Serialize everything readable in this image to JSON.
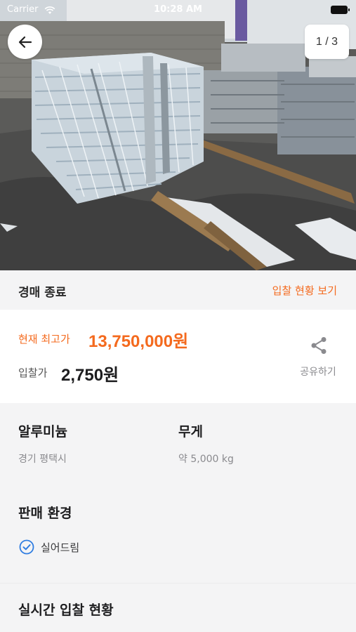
{
  "status_bar": {
    "carrier": "Carrier",
    "time": "10:28 AM"
  },
  "gallery": {
    "indicator": "1 / 3"
  },
  "auction": {
    "status": "경매 종료",
    "bid_status_link": "입찰 현황 보기"
  },
  "price": {
    "current_label": "현재 최고가",
    "current_value": "13,750,000원",
    "start_label": "입찰가",
    "start_value": "2,750원",
    "share_label": "공유하기"
  },
  "details": {
    "material": "알루미늄",
    "location": "경기 평택시",
    "weight_title": "무게",
    "weight_value": "약 5,000 kg",
    "env_title": "판매 환경",
    "env_option": "실어드림",
    "live_title": "실시간 입찰 현황"
  },
  "colors": {
    "accent": "#f46a1e",
    "check": "#2f7de1"
  },
  "icons": {
    "back": "arrow-left-icon",
    "share": "share-icon",
    "check": "check-circle-icon"
  }
}
